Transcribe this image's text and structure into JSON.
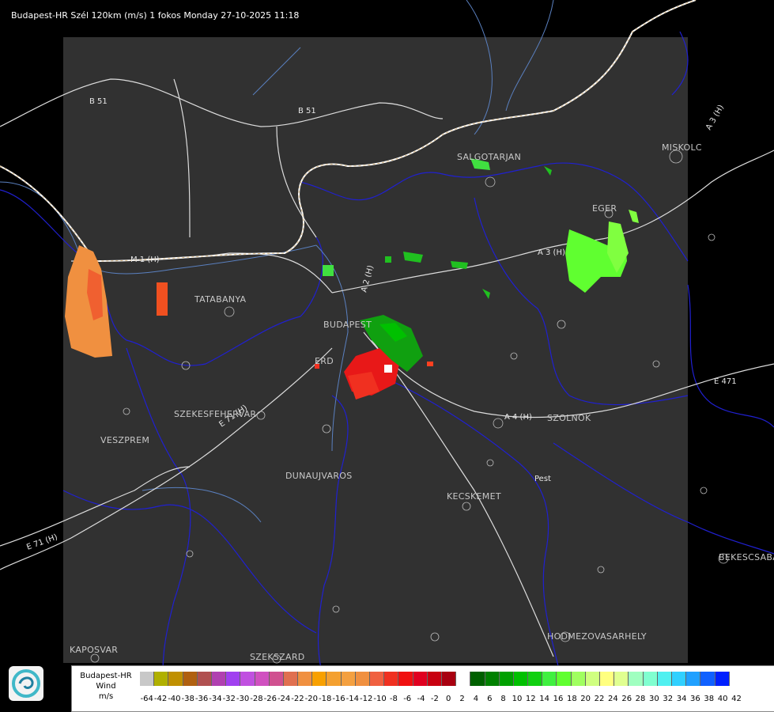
{
  "title": "Budapest-HR Szél 120km (m/s) 1 fokos Monday 27-10-2025 11:18",
  "places": [
    {
      "name": "SALGOTARJAN"
    },
    {
      "name": "MISKOLC"
    },
    {
      "name": "EGER"
    },
    {
      "name": "TATABANYA"
    },
    {
      "name": "BUDAPEST"
    },
    {
      "name": "ERD"
    },
    {
      "name": "SZEKESFEHERVAR"
    },
    {
      "name": "VESZPREM"
    },
    {
      "name": "DUNAUJVAROS"
    },
    {
      "name": "KECSKEMET"
    },
    {
      "name": "SZOLNOK"
    },
    {
      "name": "BEKESCSABA"
    },
    {
      "name": "HODMEZOVASARHELY"
    },
    {
      "name": "KAPOSVAR"
    },
    {
      "name": "SZEKSZARD"
    }
  ],
  "roads": [
    "B 51",
    "B 51",
    "M 1 (H)",
    "A 2 (H)",
    "A 3 (H)",
    "A 3 (H)",
    "A 4 (H)",
    "E 71 (H)",
    "E 71 (H)",
    "E 471",
    "Pest"
  ],
  "legend": {
    "line1": "Budapest-HR",
    "line2": "Wind",
    "line3": "m/s",
    "colors": [
      "#c8c8c8",
      "#b0b000",
      "#c09000",
      "#b06010",
      "#b05050",
      "#b040b0",
      "#a040f0",
      "#c050e0",
      "#d050c0",
      "#d05090",
      "#e07050",
      "#f09040",
      "#f8a000",
      "#f4a030",
      "#f4a040",
      "#f09040",
      "#f06040",
      "#f03020",
      "#f01010",
      "#e00020",
      "#c80010",
      "#a80010",
      "#ffffff",
      "#006000",
      "#008000",
      "#00a000",
      "#00c000",
      "#10d010",
      "#40f040",
      "#60ff30",
      "#a0ff60",
      "#d0ff80",
      "#ffff80",
      "#e0ff90",
      "#a0ffc0",
      "#80ffd0",
      "#50f0f0",
      "#30d0ff",
      "#20a0ff",
      "#1060ff",
      "#0020ff"
    ],
    "ticks": [
      "-64",
      "-42",
      "-40",
      "-38",
      "-36",
      "-34",
      "-32",
      "-30",
      "-28",
      "-26",
      "-24",
      "-22",
      "-20",
      "-18",
      "-16",
      "-14",
      "-12",
      "-10",
      "-8",
      "-6",
      "-4",
      "-2",
      "0",
      "2",
      "4",
      "6",
      "8",
      "10",
      "12",
      "14",
      "16",
      "18",
      "20",
      "22",
      "24",
      "26",
      "28",
      "30",
      "32",
      "34",
      "36",
      "38",
      "40",
      "42"
    ]
  }
}
